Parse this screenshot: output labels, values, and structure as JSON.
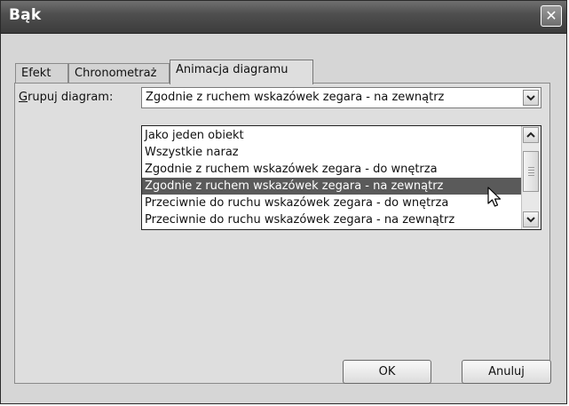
{
  "window": {
    "title": "Bąk",
    "close_glyph": "✕"
  },
  "tabs": [
    {
      "label": "Efekt"
    },
    {
      "label": "Chronometraż"
    },
    {
      "label": "Animacja diagramu",
      "active": true
    }
  ],
  "group": {
    "label_accel": "G",
    "label_rest": "rupuj diagram:",
    "value": "Zgodnie z ruchem wskazówek zegara - na zewnątrz",
    "options": [
      "Jako jeden obiekt",
      "Wszystkie naraz",
      "Zgodnie z ruchem wskazówek zegara - do wnętrza",
      "Zgodnie z ruchem wskazówek zegara - na zewnątrz",
      "Przeciwnie do ruchu wskazówek zegara - do wnętrza",
      "Przeciwnie do ruchu wskazówek zegara - na zewnątrz"
    ],
    "selected_index": 3
  },
  "buttons": {
    "ok": "OK",
    "cancel": "Anuluj"
  },
  "icons": {
    "dropdown": "chevron-down-icon",
    "scroll_up": "chevron-up-icon",
    "scroll_down": "chevron-down-icon",
    "pointer": "mouse-cursor-icon",
    "close": "close-icon"
  },
  "colors": {
    "titlebar": "#4f4f4f",
    "selection": "#5a5a5a",
    "dialog": "#d6d6d6"
  }
}
